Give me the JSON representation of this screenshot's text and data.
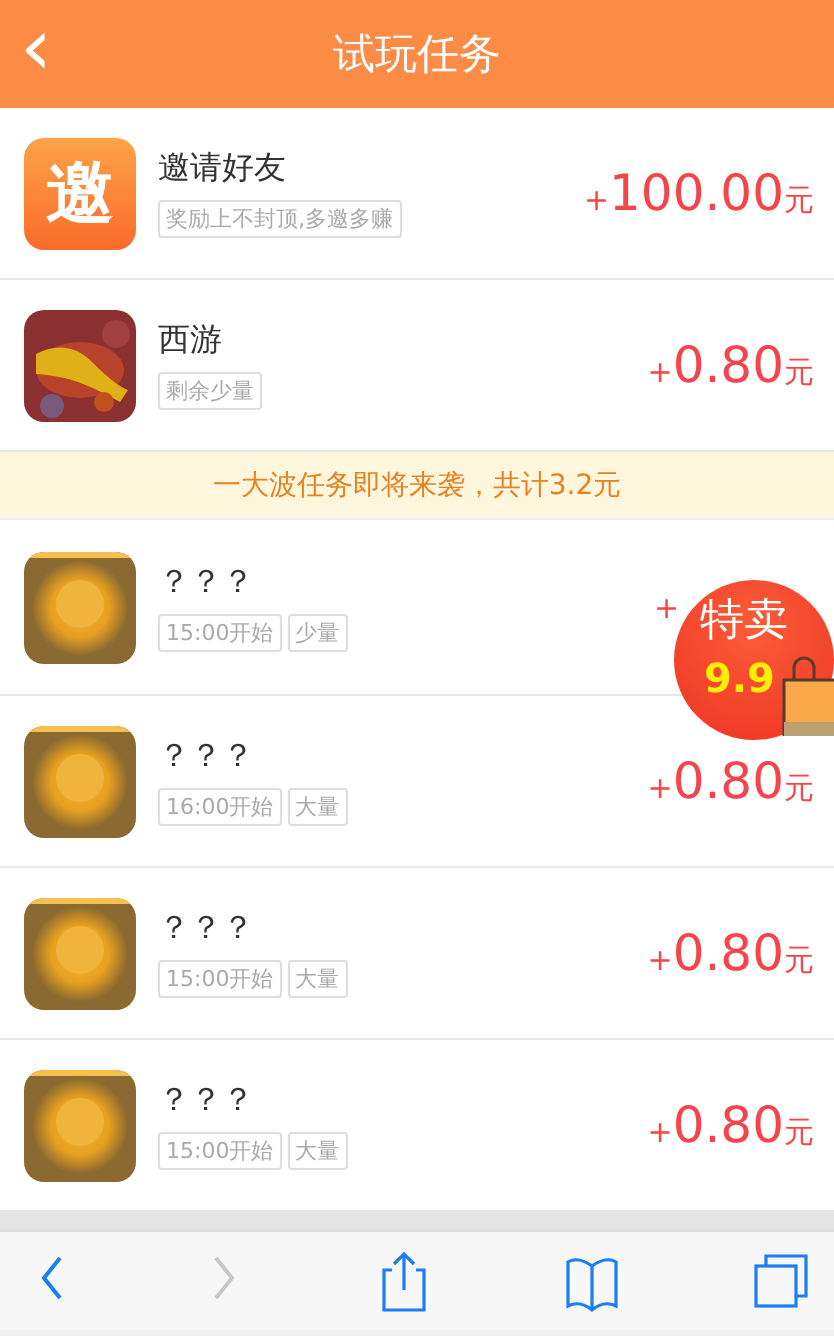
{
  "header": {
    "back_icon": "‹",
    "title": "试玩任务"
  },
  "tasks": [
    {
      "thumb": {
        "kind": "logo",
        "text": "邀"
      },
      "title": "邀请好友",
      "tags": [
        "奖励上不封顶,多邀多赚"
      ],
      "sign": "+",
      "amount": "100.00",
      "unit": "元"
    },
    {
      "thumb": {
        "kind": "picture"
      },
      "title": "西游",
      "tags": [
        "剩余少量"
      ],
      "sign": "+",
      "amount": "0.80",
      "unit": "元"
    }
  ],
  "banner": "一大波任务即将来袭，共计3.2元",
  "upcoming": [
    {
      "thumb": {
        "kind": "picture"
      },
      "title": "？？？",
      "tags": [
        "15:00开始",
        "少量"
      ],
      "sign": "+"
    },
    {
      "thumb": {
        "kind": "picture"
      },
      "title": "？？？",
      "tags": [
        "16:00开始",
        "大量"
      ],
      "sign": "+",
      "amount": "0.80",
      "unit": "元"
    },
    {
      "thumb": {
        "kind": "picture"
      },
      "title": "？？？",
      "tags": [
        "15:00开始",
        "大量"
      ],
      "sign": "+",
      "amount": "0.80",
      "unit": "元"
    },
    {
      "thumb": {
        "kind": "picture"
      },
      "title": "？？？",
      "tags": [
        "15:00开始",
        "大量"
      ],
      "sign": "+",
      "amount": "0.80",
      "unit": "元"
    }
  ],
  "promo_badge": {
    "line1": "特卖",
    "line2": "9.9"
  },
  "toolbar": [
    {
      "kind": "back",
      "disabled": false
    },
    {
      "kind": "forward",
      "disabled": true
    },
    {
      "kind": "share",
      "disabled": false
    },
    {
      "kind": "bookmarks",
      "disabled": false
    },
    {
      "kind": "tabs",
      "disabled": false
    }
  ]
}
